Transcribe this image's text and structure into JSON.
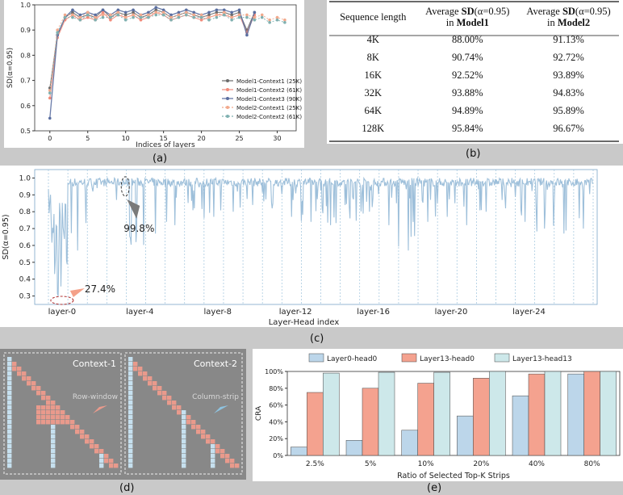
{
  "captions": {
    "a": "(a)",
    "b": "(b)",
    "c": "(c)",
    "d": "(d)",
    "e": "(e)"
  },
  "chart_data": [
    {
      "id": "a",
      "type": "line",
      "xlabel": "Indices of layers",
      "ylabel": "SD(α=0.95)",
      "xlim": [
        -2,
        32.5
      ],
      "ylim": [
        0.5,
        1.0
      ],
      "xticks": [
        "0",
        "5",
        "10",
        "15",
        "20",
        "25",
        "30"
      ],
      "yticks": [
        "0.5",
        "0.6",
        "0.7",
        "0.8",
        "0.9",
        "1.0"
      ],
      "legend_position": "lower-right",
      "x": [
        0,
        1,
        2,
        3,
        4,
        5,
        6,
        7,
        8,
        9,
        10,
        11,
        12,
        13,
        14,
        15,
        16,
        17,
        18,
        19,
        20,
        21,
        22,
        23,
        24,
        25,
        26,
        27,
        28,
        29,
        30,
        31
      ],
      "series": [
        {
          "name": "Model1-Context1 (25K)",
          "color": "#6b6b6b",
          "values": [
            0.67,
            0.88,
            0.95,
            0.97,
            0.95,
            0.96,
            0.95,
            0.98,
            0.95,
            0.97,
            0.96,
            0.97,
            0.95,
            0.96,
            0.98,
            0.97,
            0.95,
            0.96,
            0.97,
            0.96,
            0.95,
            0.96,
            0.97,
            0.97,
            0.96,
            0.97,
            0.9,
            0.97
          ]
        },
        {
          "name": "Model1-Context2 (61K)",
          "color": "#f08a7a",
          "values": [
            0.63,
            0.87,
            0.94,
            0.96,
            0.94,
            0.95,
            0.94,
            0.97,
            0.94,
            0.96,
            0.95,
            0.96,
            0.94,
            0.95,
            0.97,
            0.96,
            0.94,
            0.95,
            0.96,
            0.95,
            0.94,
            0.95,
            0.96,
            0.96,
            0.95,
            0.96,
            0.89,
            0.96
          ]
        },
        {
          "name": "Model1-Context3 (90K)",
          "color": "#5a6ea0",
          "values": [
            0.55,
            0.88,
            0.95,
            0.98,
            0.96,
            0.97,
            0.96,
            0.98,
            0.96,
            0.98,
            0.97,
            0.98,
            0.96,
            0.97,
            0.99,
            0.98,
            0.96,
            0.97,
            0.98,
            0.97,
            0.96,
            0.97,
            0.98,
            0.98,
            0.97,
            0.98,
            0.88,
            0.97
          ]
        },
        {
          "name": "Model2-Context1 (25K)",
          "color": "#f2a98c",
          "values": [
            0.66,
            0.9,
            0.96,
            0.96,
            0.95,
            0.97,
            0.95,
            0.96,
            0.96,
            0.97,
            0.95,
            0.96,
            0.96,
            0.96,
            0.97,
            0.97,
            0.95,
            0.96,
            0.97,
            0.96,
            0.96,
            0.95,
            0.96,
            0.97,
            0.95,
            0.96,
            0.96,
            0.95,
            0.96,
            0.94,
            0.95,
            0.94
          ]
        },
        {
          "name": "Model2-Context2 (61K)",
          "color": "#7fb0b0",
          "values": [
            0.65,
            0.89,
            0.95,
            0.95,
            0.94,
            0.96,
            0.94,
            0.95,
            0.95,
            0.96,
            0.94,
            0.95,
            0.95,
            0.95,
            0.96,
            0.96,
            0.94,
            0.95,
            0.96,
            0.95,
            0.95,
            0.94,
            0.95,
            0.96,
            0.94,
            0.95,
            0.95,
            0.94,
            0.95,
            0.93,
            0.94,
            0.93
          ]
        }
      ]
    },
    {
      "id": "b",
      "type": "table",
      "headers": [
        "Sequence length",
        "Average SD(α=0.95) in Model1",
        "Average SD(α=0.95) in Model2"
      ],
      "header_parts": [
        {
          "line1": "Sequence length",
          "line2": ""
        },
        {
          "line1a": "Average ",
          "line1b": "SD",
          "line1c": "(α=0.95)",
          "line2a": "in ",
          "line2b": "Model1"
        },
        {
          "line1a": "Average ",
          "line1b": "SD",
          "line1c": "(α=0.95)",
          "line2a": "in ",
          "line2b": "Model2"
        }
      ],
      "rows": [
        [
          "4K",
          "88.00%",
          "91.13%"
        ],
        [
          "8K",
          "90.74%",
          "92.72%"
        ],
        [
          "16K",
          "92.52%",
          "93.89%"
        ],
        [
          "32K",
          "93.88%",
          "94.83%"
        ],
        [
          "64K",
          "94.89%",
          "95.89%"
        ],
        [
          "128K",
          "95.84%",
          "96.67%"
        ]
      ]
    },
    {
      "id": "c",
      "type": "line",
      "xlabel": "Layer-Head index",
      "ylabel": "SD(α=0.95)",
      "ylim": [
        0.25,
        1.05
      ],
      "yticks": [
        "0.3",
        "0.4",
        "0.5",
        "0.6",
        "0.7",
        "0.8",
        "0.9",
        "1.0"
      ],
      "xticks": [
        "layer-0",
        "layer-4",
        "layer-8",
        "layer-12",
        "layer-16",
        "layer-20",
        "layer-24"
      ],
      "layers": 28,
      "heads_per_layer": 28,
      "color": "#9dbfda",
      "layer_min_sd": [
        0.28,
        0.55,
        0.92,
        0.85,
        0.6,
        0.65,
        0.7,
        0.8,
        0.75,
        0.78,
        0.82,
        0.8,
        0.75,
        0.72,
        0.7,
        0.74,
        0.78,
        0.7,
        0.55,
        0.72,
        0.75,
        0.7,
        0.78,
        0.8,
        0.72,
        0.68,
        0.65,
        0.68
      ],
      "annotations": [
        {
          "text": "27.4%",
          "layer": 0,
          "value": 0.274,
          "arrow_color": "#f4a088"
        },
        {
          "text": "99.8%",
          "layer": 3,
          "value": 0.998,
          "arrow_color": "#7a7a7a"
        }
      ]
    },
    {
      "id": "e",
      "type": "bar",
      "xlabel": "Ratio of Selected Top-K Strips",
      "ylabel": "CRA",
      "ylim": [
        0,
        100
      ],
      "yticks": [
        "0%",
        "20%",
        "40%",
        "60%",
        "80%",
        "100%"
      ],
      "categories": [
        "2.5%",
        "5%",
        "10%",
        "20%",
        "40%",
        "80%"
      ],
      "legend_position": "top",
      "series": [
        {
          "name": "Layer0-head0",
          "color": "#bcd6ea",
          "values": [
            10,
            18,
            30,
            47,
            71,
            97
          ]
        },
        {
          "name": "Layer13-head0",
          "color": "#f4a28f",
          "values": [
            75,
            80,
            86,
            92,
            97,
            100
          ]
        },
        {
          "name": "Layer13-head13",
          "color": "#cde8ea",
          "values": [
            98,
            99,
            99,
            100,
            100,
            100
          ]
        }
      ]
    }
  ],
  "panel_d": {
    "left_title": "Context-1",
    "right_title": "Context-2",
    "left_note": "Row-window",
    "right_note": "Column-strip"
  }
}
